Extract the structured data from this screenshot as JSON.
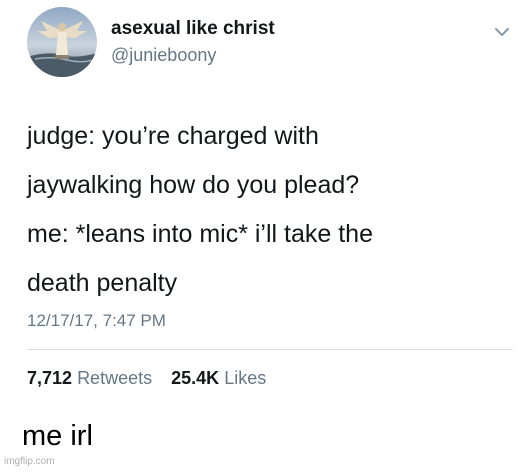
{
  "tweet": {
    "display_name": "asexual like christ",
    "handle": "@junieboony",
    "text_lines": [
      "judge: you’re charged with",
      "jaywalking how do you plead?",
      "me: *leans into mic* i’ll take the",
      "death penalty"
    ],
    "timestamp": "12/17/17, 7:47 PM",
    "retweets_count": "7,712",
    "retweets_label": "Retweets",
    "likes_count": "25.4K",
    "likes_label": "Likes",
    "menu_icon": "chevron-down-icon",
    "avatar_icon": "angel-statue-avatar"
  },
  "caption": "me irl",
  "watermark": "imgflip.com",
  "colors": {
    "primary_text": "#14171a",
    "secondary_text": "#657786",
    "divider": "#d6dde3",
    "background": "#ffffff"
  }
}
